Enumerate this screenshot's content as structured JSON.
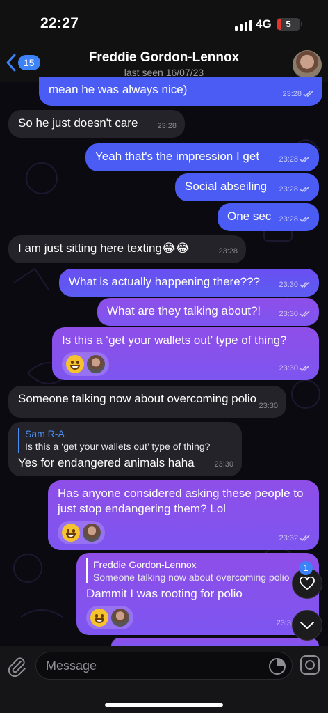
{
  "status_bar": {
    "time": "22:27",
    "network": "4G",
    "battery": "5"
  },
  "header": {
    "back_count": "15",
    "contact_name": "Freddie Gordon-Lennox",
    "last_seen": "last seen 16/07/23"
  },
  "messages": [
    {
      "direction": "out",
      "text": "mean he was always nice)",
      "time": "23:28"
    },
    {
      "direction": "in",
      "text": "So he just doesn't care",
      "time": "23:28"
    },
    {
      "direction": "out",
      "text": "Yeah that's the impression I get",
      "time": "23:28"
    },
    {
      "direction": "out",
      "text": "Social abseiling",
      "time": "23:28"
    },
    {
      "direction": "out",
      "text": "One sec",
      "time": "23:28"
    },
    {
      "direction": "in",
      "text": "I am just sitting here texting😂😂",
      "time": "23:28"
    },
    {
      "direction": "out",
      "text": "What is actually happening there???",
      "time": "23:30"
    },
    {
      "direction": "out",
      "text": "What are they talking about?!",
      "time": "23:30"
    },
    {
      "direction": "out",
      "text": "Is this a ‘get your wallets out’ type of thing?",
      "time": "23:30"
    },
    {
      "direction": "in",
      "text": "Someone talking now about overcoming polio",
      "time": "23:30"
    },
    {
      "direction": "in",
      "reply_author": "Sam R-A",
      "reply_text": "Is this a ‘get your wallets out’ type of thing?",
      "text": "Yes for endangered animals haha",
      "time": "23:30"
    },
    {
      "direction": "out",
      "text": "Has anyone considered asking these people to just stop endangering them? Lol",
      "time": "23:32"
    },
    {
      "direction": "out",
      "reply_author": "Freddie Gordon-Lennox",
      "reply_text": "Someone talking now about overcoming polio",
      "text": "Dammit I was rooting for polio",
      "time": "23:3"
    }
  ],
  "reactions_badge": "1",
  "composer": {
    "placeholder": "Message"
  },
  "colors": {
    "outgoing": "#5b5cf2",
    "outgoing_purple": "#8f4ee8",
    "incoming": "#242329",
    "accent": "#3e82f7"
  }
}
